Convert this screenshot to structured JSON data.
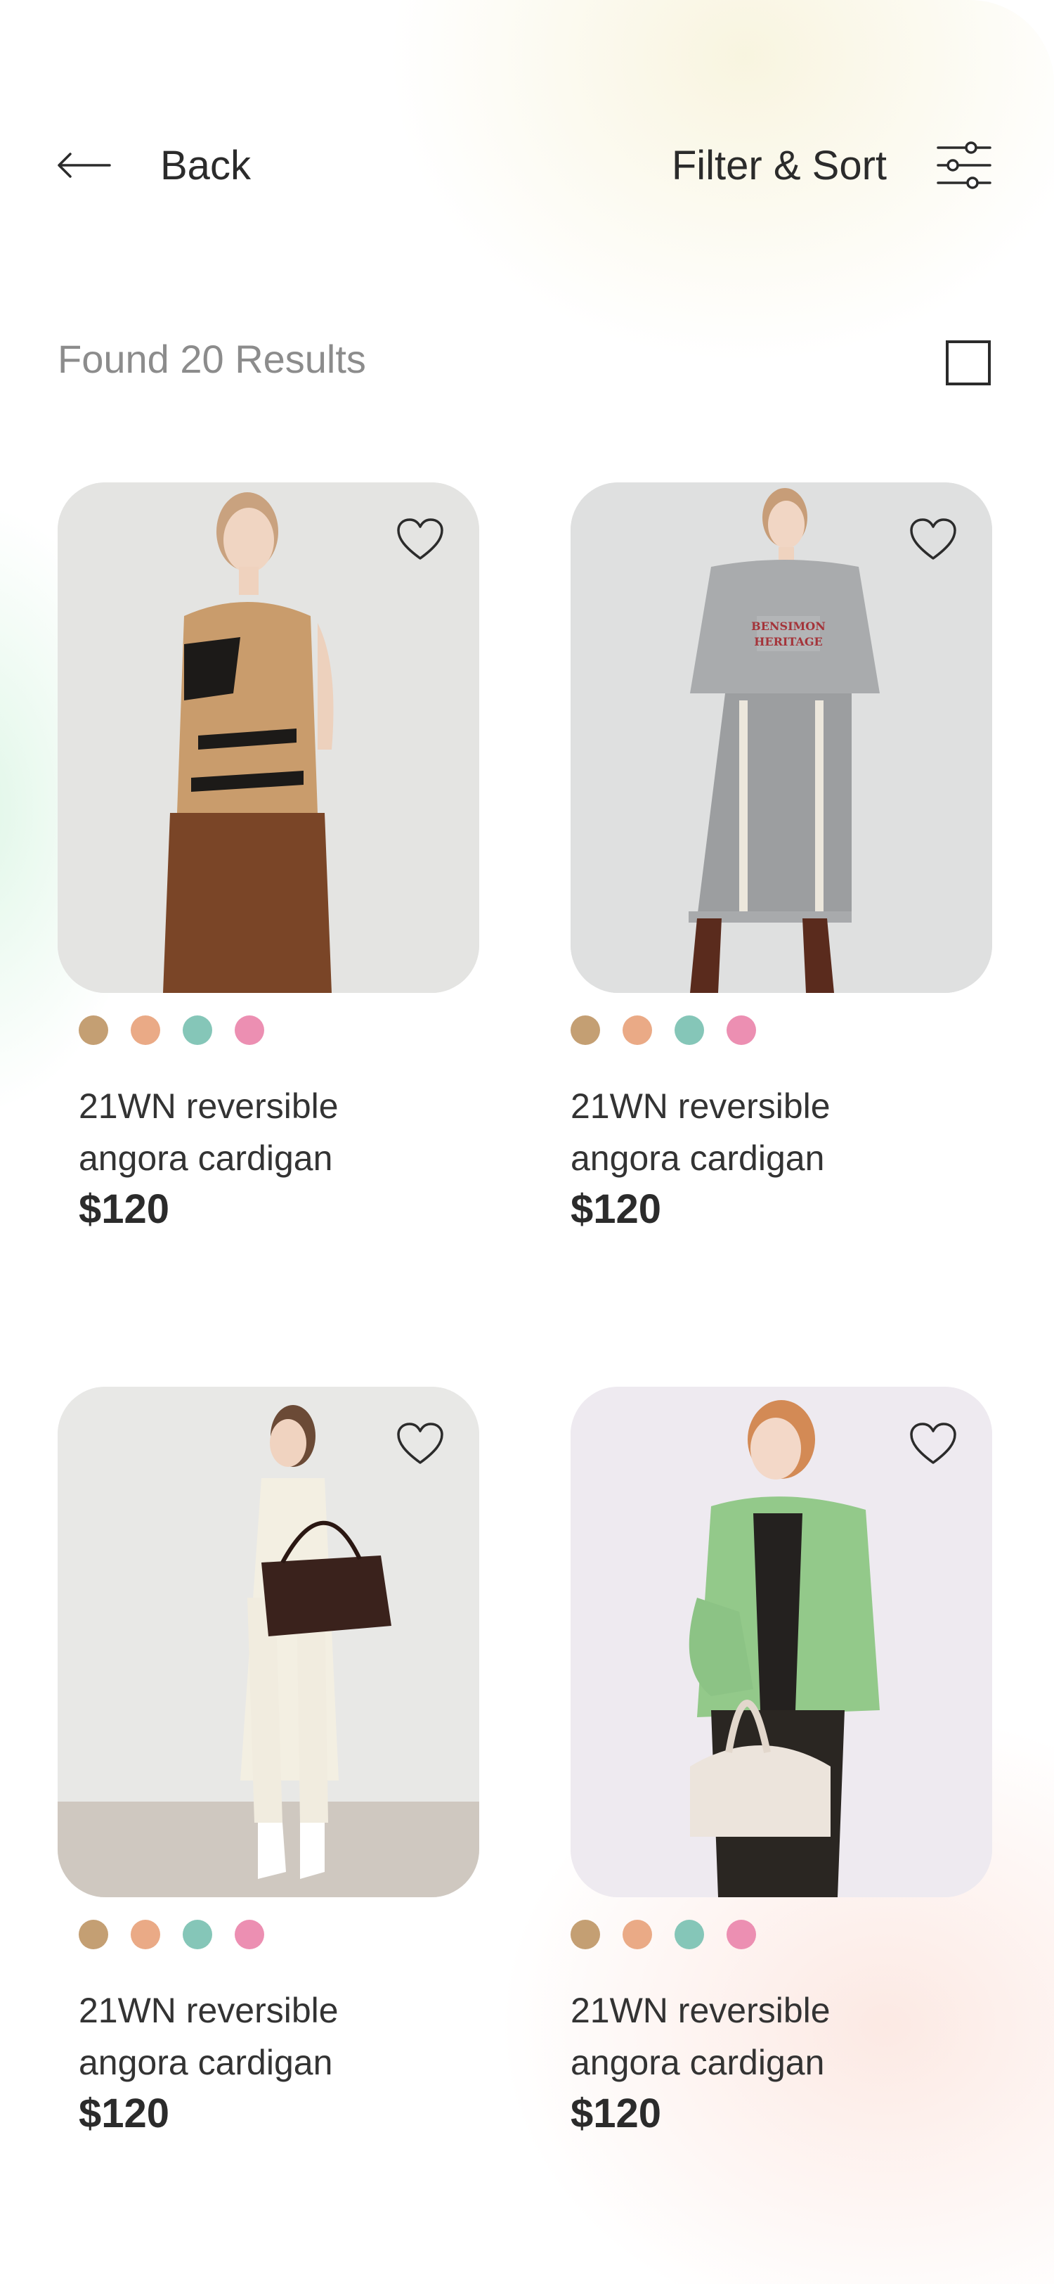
{
  "header": {
    "back_label": "Back",
    "filter_label": "Filter & Sort"
  },
  "results": {
    "label": "Found 20 Results"
  },
  "colors": {
    "swatches": [
      "#c49f73",
      "#eaaa86",
      "#85c6b8",
      "#ec8fb2"
    ],
    "text_dark": "#2b2b2b",
    "text_muted": "#8c8c8c"
  },
  "products": [
    {
      "name_line1": "21WN reversible",
      "name_line2": "angora cardigan",
      "price": "$120",
      "favorited": false
    },
    {
      "name_line1": "21WN reversible",
      "name_line2": "angora cardigan",
      "price": "$120",
      "favorited": false
    },
    {
      "name_line1": "21WN reversible",
      "name_line2": "angora cardigan",
      "price": "$120",
      "favorited": false
    },
    {
      "name_line1": "21WN reversible",
      "name_line2": "angora cardigan",
      "price": "$120",
      "favorited": false
    }
  ],
  "icons": {
    "back": "arrow-left-icon",
    "filter": "sliders-icon",
    "view_toggle": "square-icon",
    "favorite": "heart-icon"
  }
}
